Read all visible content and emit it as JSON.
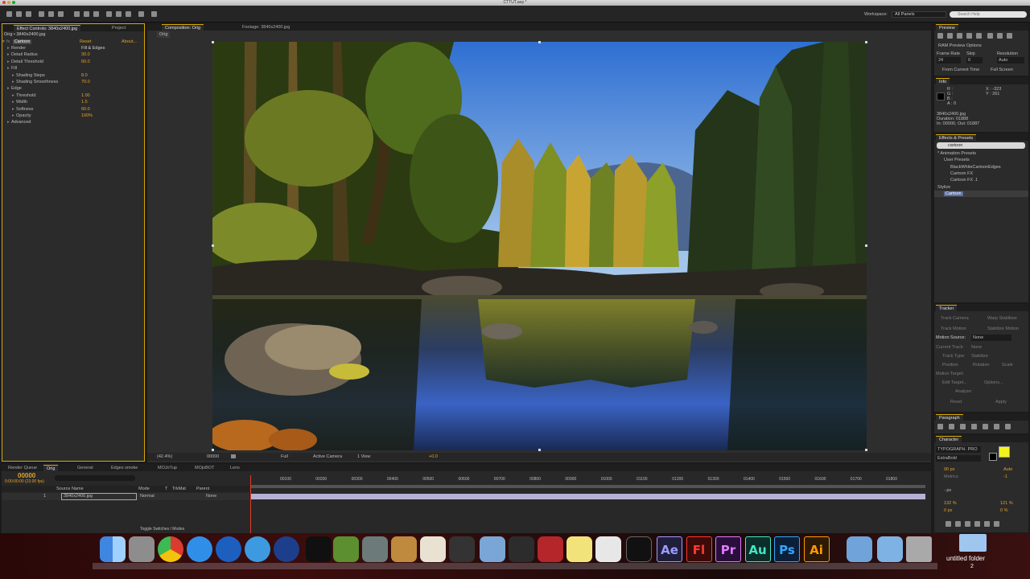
{
  "app": {
    "title": "CTTUT.aep *",
    "workspace_label": "Workspace:",
    "workspace_value": "All Panels",
    "search_placeholder": "Search Help"
  },
  "effect_controls": {
    "tab_label": "Effect Controls: 3840x2400.jpg",
    "project_tab": "Project",
    "layer_path": "Orig • 3840x2400.jpg",
    "effect_name": "Cartoon",
    "reset": "Reset",
    "about": "About...",
    "params": [
      {
        "label": "Render",
        "value": "Fill & Edges",
        "indent": 1
      },
      {
        "label": "Detail Radius",
        "value": "30.0",
        "indent": 1
      },
      {
        "label": "Detail Threshold",
        "value": "60.0",
        "indent": 1
      },
      {
        "label": "Fill",
        "value": "",
        "indent": 1
      },
      {
        "label": "Shading Steps",
        "value": "8.0",
        "indent": 2
      },
      {
        "label": "Shading Smoothness",
        "value": "70.0",
        "indent": 2
      },
      {
        "label": "Edge",
        "value": "",
        "indent": 1
      },
      {
        "label": "Threshold",
        "value": "1.00",
        "indent": 2
      },
      {
        "label": "Width",
        "value": "1.5",
        "indent": 2
      },
      {
        "label": "Softness",
        "value": "60.0",
        "indent": 2
      },
      {
        "label": "Opacity",
        "value": "100%",
        "indent": 2
      },
      {
        "label": "Advanced",
        "value": "",
        "indent": 1
      }
    ]
  },
  "composition": {
    "tab_label": "Composition: Orig",
    "footage_tab": "Footage: 3840x2400.jpg",
    "sub_tab": "Orig",
    "footer": {
      "zoom": "(42.4%)",
      "timecode": "00000",
      "resolution": "Full",
      "camera": "Active Camera",
      "view": "1 View",
      "exposure": "+0.0"
    }
  },
  "preview": {
    "title": "Preview",
    "ram_options": "RAM Preview Options",
    "frame_rate_label": "Frame Rate",
    "skip_label": "Skip",
    "resolution_label": "Resolution",
    "frame_rate_value": "24",
    "skip_value": "0",
    "resolution_value": "Auto",
    "from_current": "From Current Time",
    "full_screen": "Full Screen"
  },
  "info": {
    "title": "Info",
    "r": "R :",
    "g": "G :",
    "b": "B :",
    "a": "A : 0",
    "x": "X : -323",
    "y": "Y : 261",
    "line1": "3840x2400.jpg",
    "line2": "Duration: 01888",
    "line3": "In: 00000, Out: 01887"
  },
  "effects_presets": {
    "title": "Effects & Presets",
    "search_value": "cartoon",
    "items": [
      {
        "label": "* Animation Presets",
        "indent": 0
      },
      {
        "label": "User Presets",
        "indent": 1
      },
      {
        "label": "BlackWhiteCartoonEdges",
        "indent": 2
      },
      {
        "label": "Cartoon FX",
        "indent": 2
      },
      {
        "label": "Cartoon FX .1",
        "indent": 2
      },
      {
        "label": "Stylize",
        "indent": 0
      },
      {
        "label": "Cartoon",
        "indent": 1
      }
    ]
  },
  "tracker": {
    "title": "Tracker",
    "track_camera": "Track Camera",
    "warp_stabilizer": "Warp Stabilizer",
    "track_motion": "Track Motion",
    "stabilize_motion": "Stabilize Motion",
    "motion_source_label": "Motion Source:",
    "motion_source_value": "None",
    "current_track_label": "Current Track:",
    "current_track_value": "None",
    "track_type_label": "Track Type:",
    "track_type_value": "Stabilize",
    "position": "Position",
    "rotation": "Rotation",
    "scale": "Scale",
    "motion_target": "Motion Target:",
    "edit_target": "Edit Target...",
    "options": "Options...",
    "analyze": "Analyze:",
    "reset": "Reset",
    "apply": "Apply"
  },
  "paragraph": {
    "title": "Paragraph"
  },
  "character": {
    "title": "Character",
    "font": "TYPOGRAPH. PRO",
    "style": "ExtraBold",
    "size": "90 px",
    "leading": "Auto",
    "kerning": "Metrics",
    "tracking": "-1",
    "stroke": "- px",
    "vscale": "132 %",
    "hscale": "121 %",
    "baseline": "0 px",
    "tsume": "0 %",
    "fill_color": "#f4f21c"
  },
  "timeline": {
    "tabs": [
      "Render Queue",
      "Orig",
      "General",
      "Edges smoke",
      "MOJoTup",
      "MOjoBOT",
      "Lens"
    ],
    "timecode": "00000",
    "timecode_sub": "0:00:00:00 (23.00 fps)",
    "columns": {
      "source": "Source Name",
      "mode": "Mode",
      "t": "T",
      "trkmat": "TrkMat",
      "parent": "Parent"
    },
    "layer": {
      "index": "1",
      "name": "3840x2400.jpg",
      "mode": "Normal",
      "parent": "None"
    },
    "ruler": [
      "00100",
      "00200",
      "00300",
      "00400",
      "00500",
      "00600",
      "00700",
      "00800",
      "00900",
      "01000",
      "01100",
      "01200",
      "01300",
      "01400",
      "01500",
      "01600",
      "01700",
      "01800"
    ],
    "toggle": "Toggle Switches / Modes"
  },
  "dock": {
    "adobe_apps": [
      {
        "label": "Ae",
        "bg": "#1f1f3d",
        "fg": "#9d9dff"
      },
      {
        "label": "Fl",
        "bg": "#3d0a0a",
        "fg": "#ff3a2f"
      },
      {
        "label": "Pr",
        "bg": "#2a0f3d",
        "fg": "#e27bff"
      },
      {
        "label": "Au",
        "bg": "#0b2e2b",
        "fg": "#42e8c2"
      },
      {
        "label": "Ps",
        "bg": "#0b1f3b",
        "fg": "#31a8ff"
      },
      {
        "label": "Ai",
        "bg": "#2d1a06",
        "fg": "#ff9a00"
      }
    ],
    "folder_label": "untitled folder",
    "folder_badge": "2"
  }
}
